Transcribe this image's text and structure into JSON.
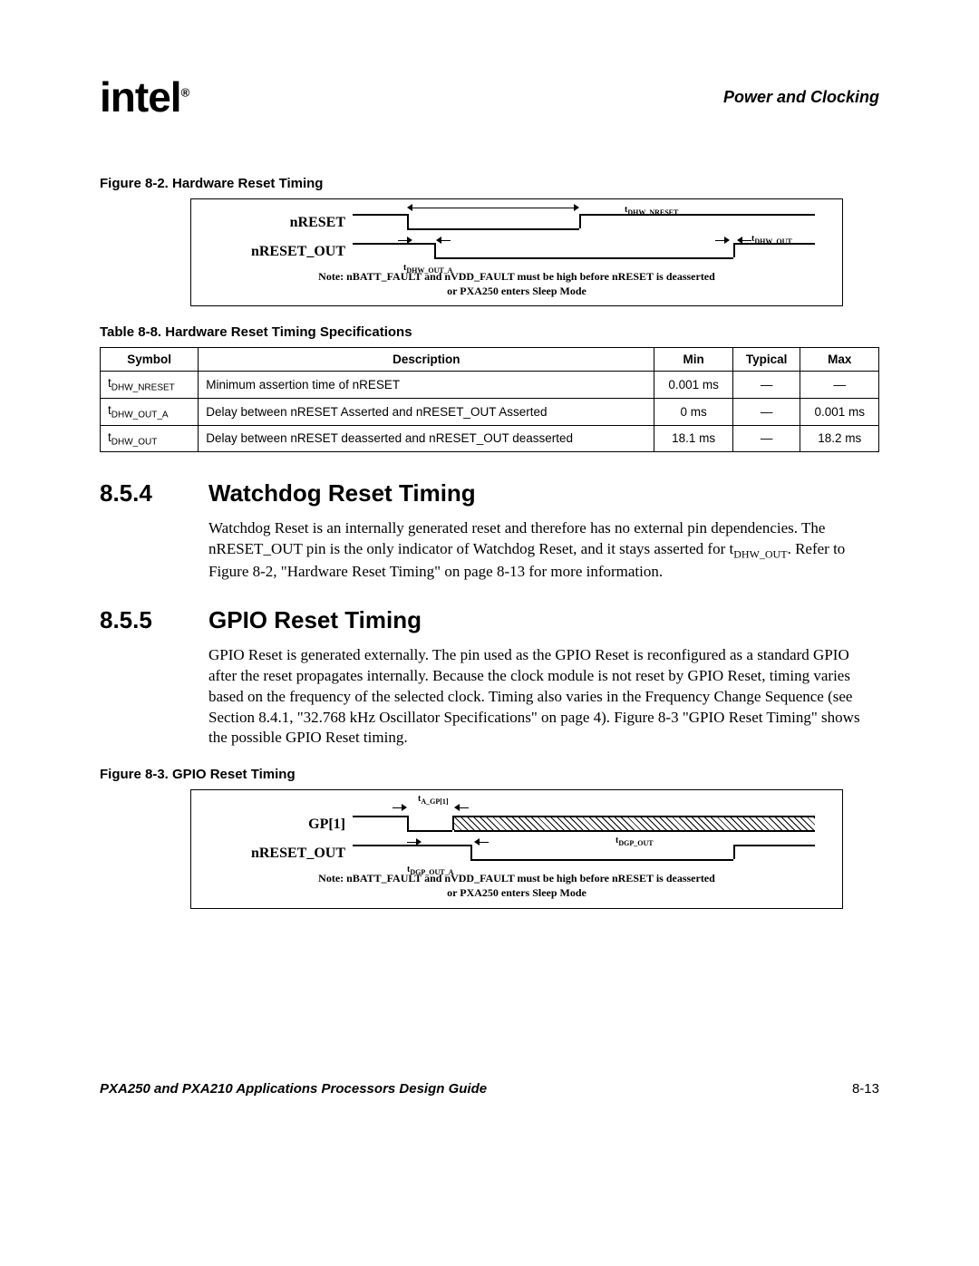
{
  "header": {
    "logo_text": "intel",
    "logo_reg": "®",
    "chapter_title": "Power and Clocking"
  },
  "figure82": {
    "caption": "Figure 8-2. Hardware Reset Timing",
    "row1_label": "nRESET",
    "row1_symbol": "tDHW_NRESET",
    "row2_label": "nRESET_OUT",
    "row2_symbol_a": "tDHW_OUT_A",
    "row2_symbol_b": "tDHW_OUT",
    "note_l1": "Note: nBATT_FAULT and nVDD_FAULT must be high before nRESET is deasserted",
    "note_l2": "or PXA250 enters Sleep Mode"
  },
  "table88": {
    "caption": "Table 8-8. Hardware Reset Timing Specifications",
    "headers": [
      "Symbol",
      "Description",
      "Min",
      "Typical",
      "Max"
    ],
    "rows": [
      {
        "sym_prefix": "t",
        "sym_sub": "DHW_NRESET",
        "desc": "Minimum assertion time of nRESET",
        "min": "0.001 ms",
        "typ": "—",
        "max": "—"
      },
      {
        "sym_prefix": "t",
        "sym_sub": "DHW_OUT_A",
        "desc": "Delay between nRESET Asserted and nRESET_OUT Asserted",
        "min": "0 ms",
        "typ": "—",
        "max": "0.001 ms"
      },
      {
        "sym_prefix": "t",
        "sym_sub": "DHW_OUT",
        "desc": "Delay between nRESET deasserted and nRESET_OUT deasserted",
        "min": "18.1 ms",
        "typ": "—",
        "max": "18.2 ms"
      }
    ]
  },
  "section854": {
    "num": "8.5.4",
    "title": "Watchdog Reset Timing",
    "para_a": "Watchdog Reset is an internally generated reset and therefore has no external pin dependencies. The nRESET_OUT pin is the only indicator of Watchdog Reset, and it stays asserted for ",
    "para_sub_prefix": "t",
    "para_sub": "DHW_OUT",
    "para_b": ". Refer to Figure 8-2, \"Hardware Reset Timing\" on page 8-13 for more information."
  },
  "section855": {
    "num": "8.5.5",
    "title": "GPIO Reset Timing",
    "para": "GPIO Reset is generated externally. The pin used as the GPIO Reset is reconfigured as a standard GPIO after the reset propagates internally. Because the clock module is not reset by GPIO Reset, timing varies based on the frequency of the selected clock. Timing also varies in the Frequency Change Sequence (see Section 8.4.1, \"32.768 kHz Oscillator Specifications\" on page 4). Figure 8-3 \"GPIO Reset Timing\"  shows the possible GPIO Reset timing."
  },
  "figure83": {
    "caption": "Figure 8-3. GPIO Reset Timing",
    "row1_label": "GP[1]",
    "row1_symbol": "tA_GP[1]",
    "row2_label": "nRESET_OUT",
    "row2_symbol_a": "tDGP_OUT_A",
    "row2_symbol_b": "tDGP_OUT",
    "note_l1": "Note: nBATT_FAULT and nVDD_FAULT must be high before nRESET is deasserted",
    "note_l2": "or PXA250 enters Sleep Mode"
  },
  "footer": {
    "doc_title": "PXA250 and PXA210 Applications Processors Design Guide",
    "page_num": "8-13"
  }
}
